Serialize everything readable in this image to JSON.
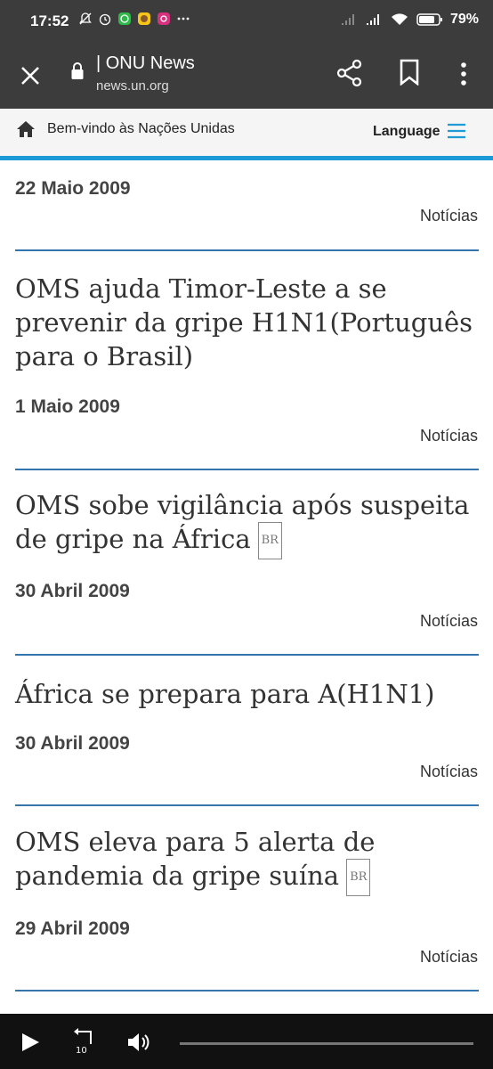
{
  "status_bar": {
    "time": "17:52",
    "battery": "79%"
  },
  "browser": {
    "title": "| ONU News",
    "url": "news.un.org"
  },
  "site_header": {
    "welcome": "Bem-vindo às Nações Unidas",
    "language": "Language"
  },
  "items": [
    {
      "title": "",
      "date": "22 Maio 2009",
      "category": "Notícias",
      "badge": ""
    },
    {
      "title": "OMS ajuda Timor-Leste a se prevenir da gripe H1N1(Português para o Brasil)",
      "date": "1 Maio 2009",
      "category": "Notícias",
      "badge": ""
    },
    {
      "title": "OMS sobe vigilância após suspeita de gripe na África",
      "date": "30 Abril 2009",
      "category": "Notícias",
      "badge": "BR"
    },
    {
      "title": "África se prepara para A(H1N1)",
      "date": "30 Abril 2009",
      "category": "Notícias",
      "badge": ""
    },
    {
      "title": "OMS eleva para 5 alerta de pandemia da gripe suína",
      "date": "29 Abril 2009",
      "category": "Notícias",
      "badge": "BR"
    }
  ],
  "player": {
    "replay_seconds": "10"
  }
}
